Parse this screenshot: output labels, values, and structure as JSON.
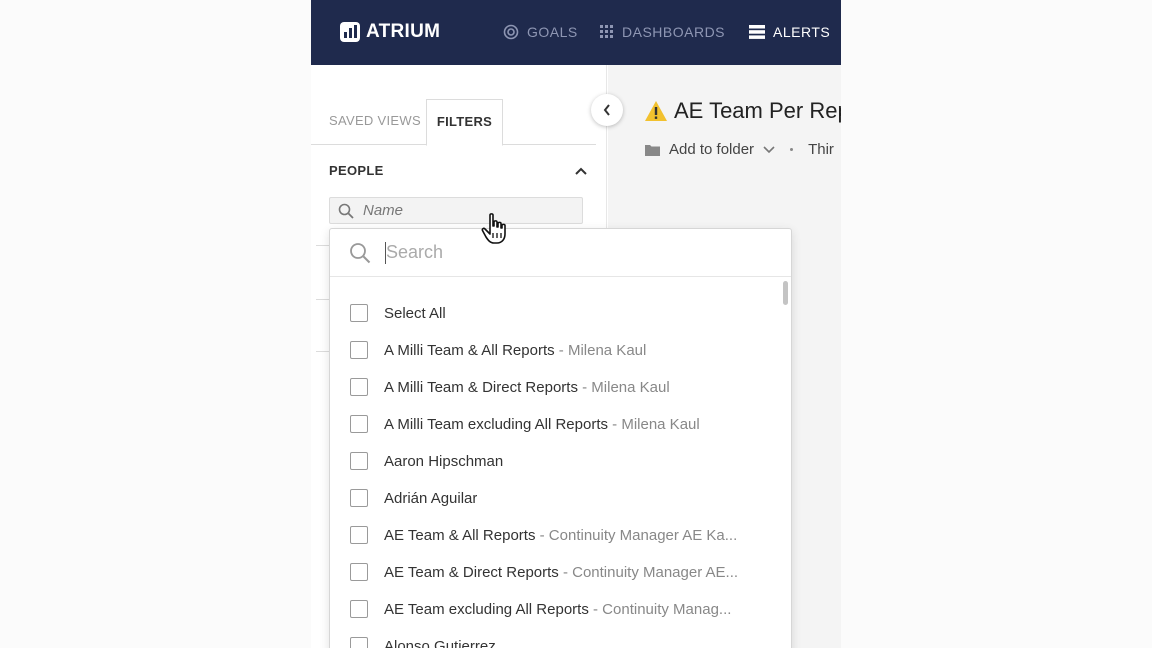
{
  "app": {
    "name": "ATRIUM"
  },
  "nav": {
    "goals": "GOALS",
    "dashboards": "DASHBOARDS",
    "alerts": "ALERTS"
  },
  "sidebar": {
    "tabs": {
      "saved_views": "SAVED VIEWS",
      "filters": "FILTERS"
    },
    "section": "PEOPLE",
    "name_placeholder": "Name"
  },
  "main": {
    "title": "AE Team Per Rep",
    "add_to_folder": "Add to folder",
    "extra": "Thir"
  },
  "dropdown": {
    "search_placeholder": "Search",
    "options": [
      {
        "label": "Select All",
        "sub": ""
      },
      {
        "label": "A Milli Team & All Reports",
        "sub": " - Milena Kaul"
      },
      {
        "label": "A Milli Team & Direct Reports",
        "sub": " - Milena Kaul"
      },
      {
        "label": "A Milli Team excluding All Reports",
        "sub": " - Milena Kaul"
      },
      {
        "label": "Aaron Hipschman",
        "sub": ""
      },
      {
        "label": "Adrián Aguilar",
        "sub": ""
      },
      {
        "label": "AE Team & All Reports",
        "sub": " - Continuity Manager AE Ka..."
      },
      {
        "label": "AE Team & Direct Reports",
        "sub": " - Continuity Manager AE..."
      },
      {
        "label": "AE Team excluding All Reports",
        "sub": " - Continuity Manag..."
      },
      {
        "label": "Alonso Gutierrez",
        "sub": ""
      }
    ]
  },
  "colors": {
    "topbar": "#1f2a4d",
    "warning": "#f2c12e"
  }
}
